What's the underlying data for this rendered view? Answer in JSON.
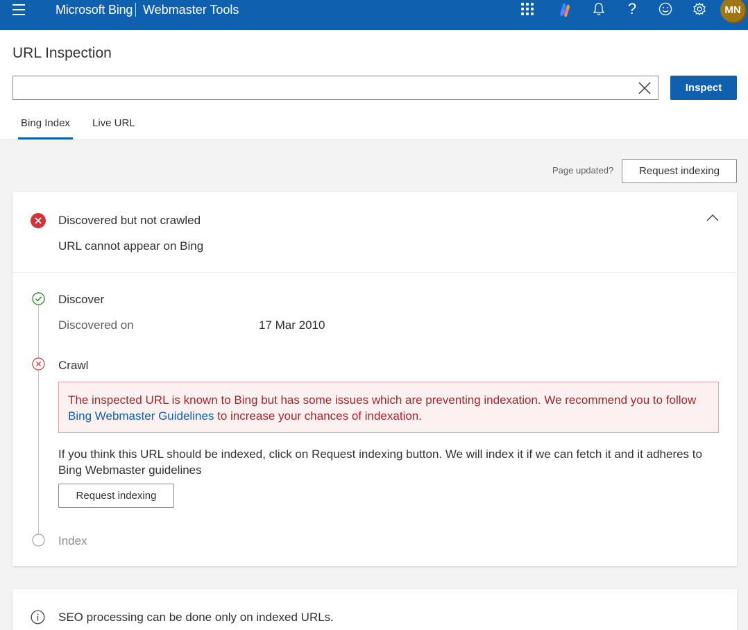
{
  "topbar": {
    "brand": "Microsoft Bing",
    "product": "Webmaster Tools",
    "avatar_initials": "MN",
    "help_glyph": "?",
    "bar_color": "#1060b0",
    "avatar_color": "#a07515"
  },
  "header": {
    "page_title": "URL Inspection",
    "search_value": "",
    "inspect_label": "Inspect",
    "tabs": [
      {
        "label": "Bing Index",
        "active": true
      },
      {
        "label": "Live URL",
        "active": false
      }
    ]
  },
  "actions": {
    "page_updated_label": "Page updated?",
    "request_indexing_label": "Request indexing"
  },
  "status": {
    "title": "Discovered but not crawled",
    "subtitle": "URL cannot appear on Bing",
    "error_color": "#d13438"
  },
  "steps": {
    "discover": {
      "title": "Discover",
      "discovered_label": "Discovered on",
      "discovered_value": "17 Mar 2010",
      "icon": "check-circle-icon"
    },
    "crawl": {
      "title": "Crawl",
      "icon": "error-circle-icon",
      "alert_before_link": "The inspected URL is known to Bing but has some issues which are preventing indexation. We recommend you to follow ",
      "alert_link": "Bing Webmaster Guidelines",
      "alert_after_link": " to increase your chances of indexation.",
      "note": "If you think this URL should be indexed, click on Request indexing button. We will index it if we can fetch it and it adheres to Bing Webmaster guidelines",
      "button_label": "Request indexing"
    },
    "index": {
      "title": "Index",
      "icon": "empty-circle-icon"
    }
  },
  "seo": {
    "text": "SEO processing can be done only on indexed URLs.",
    "icon": "info-icon"
  }
}
